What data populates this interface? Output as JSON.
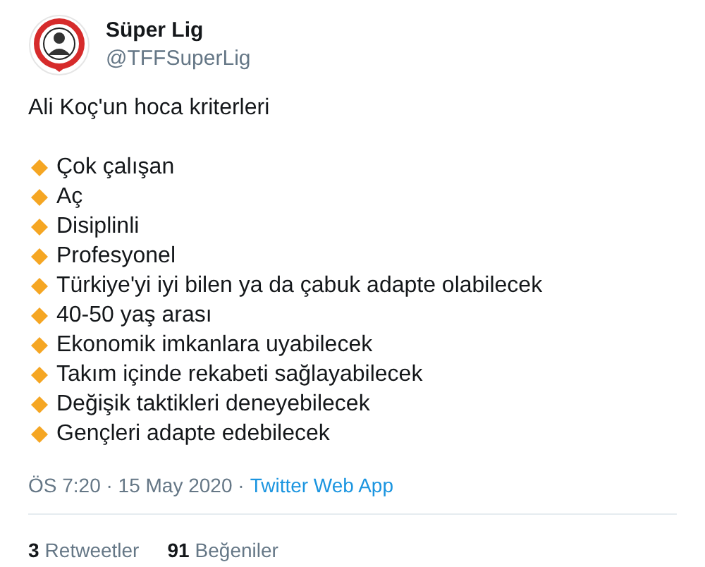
{
  "author": {
    "name": "Süper Lig",
    "handle": "@TFFSuperLig"
  },
  "tweet": {
    "intro": "Ali Koç'un hoca kriterleri",
    "items": [
      "Çok çalışan",
      "Aç",
      "Disiplinli",
      "Profesyonel",
      "Türkiye'yi iyi bilen ya da çabuk adapte olabilecek",
      "40-50 yaş arası",
      "Ekonomik imkanlara uyabilecek",
      "Takım içinde rekabeti sağlayabilecek",
      "Değişik taktikleri deneyebilecek",
      "Gençleri adapte edebilecek"
    ]
  },
  "meta": {
    "time": "ÖS 7:20 · 15 May 2020 ·",
    "source": "Twitter Web App"
  },
  "stats": [
    {
      "count": "3",
      "label": "Retweetler"
    },
    {
      "count": "91",
      "label": "Beğeniler"
    }
  ]
}
